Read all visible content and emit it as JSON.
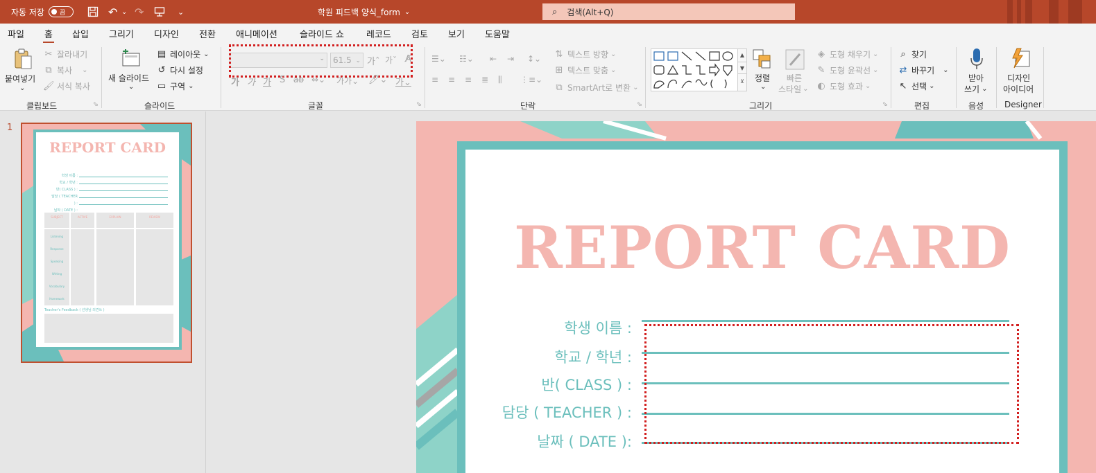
{
  "titlebar": {
    "autosave_label": "자동 저장",
    "autosave_state": "끔",
    "save_icon": "save-icon",
    "undo_icon": "undo-icon",
    "redo_icon": "redo-icon",
    "present_icon": "present-icon",
    "doc_title": "학원 피드백 양식_form",
    "search_placeholder": "검색(Alt+Q)",
    "accent": "#b7472a"
  },
  "menu": {
    "tabs": [
      "파일",
      "홈",
      "삽입",
      "그리기",
      "디자인",
      "전환",
      "애니메이션",
      "슬라이드 쇼",
      "레코드",
      "검토",
      "보기",
      "도움말"
    ],
    "active": "홈"
  },
  "ribbon": {
    "clipboard": {
      "paste": "붙여넣기",
      "cut": "잘라내기",
      "copy": "복사",
      "format_painter": "서식 복사",
      "label": "클립보드"
    },
    "slides": {
      "new_slide": "새 슬라이드",
      "layout": "레이아웃",
      "reset": "다시 설정",
      "section": "구역",
      "label": "슬라이드"
    },
    "font": {
      "font_name": "",
      "font_size": "61.5",
      "label": "글꼴"
    },
    "paragraph": {
      "text_direction": "텍스트 방향",
      "align_text": "텍스트 맞춤",
      "smartart": "SmartArt로 변환",
      "label": "단락"
    },
    "drawing": {
      "arrange": "정렬",
      "quick_styles_1": "빠른",
      "quick_styles_2": "스타일",
      "shape_fill": "도형 채우기",
      "shape_outline": "도형 윤곽선",
      "shape_effects": "도형 효과",
      "label": "그리기"
    },
    "editing": {
      "find": "찾기",
      "replace": "바꾸기",
      "select": "선택",
      "label": "편집"
    },
    "voice": {
      "dictate_1": "받아",
      "dictate_2": "쓰기",
      "label": "음성"
    },
    "designer": {
      "ideas_1": "디자인",
      "ideas_2": "아이디어",
      "label": "Designer"
    }
  },
  "thumbnails": {
    "slide_number": "1",
    "title": "REPORT CARD",
    "fields": [
      "학생 이름 :",
      "학교 / 학년 :",
      "반( CLASS ) :",
      "담당 ( TEACHER ) :",
      "날짜 ( DATE ) :"
    ],
    "columns": [
      "SUBJECT",
      "ACTIVE",
      "EXPLAIN",
      "REVIEW"
    ],
    "subjects": [
      "Listening",
      "Response",
      "Speaking",
      "Writing",
      "Vocabulary",
      "Homework"
    ],
    "feedback": "Teacher's Feedback ( 선생님 의견쓰 )"
  },
  "slide": {
    "title": "REPORT   CARD",
    "fields": [
      {
        "label": "학생 이름 :"
      },
      {
        "label": "학교 / 학년 :"
      },
      {
        "label": "반( CLASS ) :"
      },
      {
        "label": "담당 ( TEACHER ) :"
      },
      {
        "label": "날짜 ( DATE ):"
      }
    ],
    "pink": "#f4b6b0",
    "teal": "#6bbfbc"
  }
}
